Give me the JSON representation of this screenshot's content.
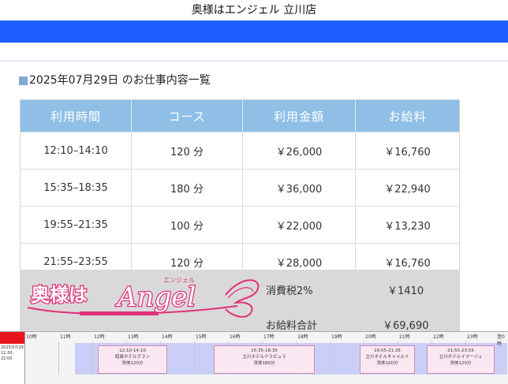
{
  "header": {
    "title": "奥様はエンジェル 立川店"
  },
  "page": {
    "heading": "2025年07月29日 のお仕事内容一覧"
  },
  "table": {
    "columns": [
      "利用時間",
      "コース",
      "利用金額",
      "お給料"
    ],
    "rows": [
      [
        "12:10–14:10",
        "120 分",
        "￥26,000",
        "￥16,760"
      ],
      [
        "15:35–18:35",
        "180 分",
        "￥36,000",
        "￥22,940"
      ],
      [
        "19:55–21:35",
        "100 分",
        "￥22,000",
        "￥13,230"
      ],
      [
        "21:55–23:55",
        "120 分",
        "￥28,000",
        "￥16,760"
      ]
    ]
  },
  "summary": {
    "tax_label": "消費税2%",
    "tax_value": "￥1410",
    "total_label": "お給料合計",
    "total_value": "￥69,690",
    "logo": {
      "main": "奥様は",
      "script": "Angel",
      "small": "エンジェル"
    }
  },
  "timeline": {
    "date": "2025/07/29",
    "range": "11:30-22:00",
    "hours": [
      "10時",
      "11時",
      "12時",
      "13時",
      "14時",
      "15時",
      "16時",
      "17時",
      "18時",
      "19時",
      "20時",
      "21時",
      "22時",
      "23時",
      "翌0時"
    ],
    "jobs": [
      {
        "time": "12:10-14:10",
        "hotel": "昭島ホテルグラン",
        "course": "洗体120分"
      },
      {
        "time": "15:35-18:35",
        "hotel": "立川ホテルクラピュラ",
        "course": "洗体180分"
      },
      {
        "time": "19:55-21:35",
        "hotel": "立川ホテルキャメルイ",
        "course": "洗体100分"
      },
      {
        "time": "21:55-23:55",
        "hotel": "立川ホテルイマージュ",
        "course": "洗体120分"
      }
    ]
  },
  "colors": {
    "top_bar": "#1f5fff",
    "table_header": "#8fbfe6",
    "summary_bg": "#d9d9d9",
    "logo_pink": "#e0307a",
    "timeline_red": "#e8141c",
    "timeline_band": "#cbcff7",
    "job_block": "#fbe7f2"
  }
}
